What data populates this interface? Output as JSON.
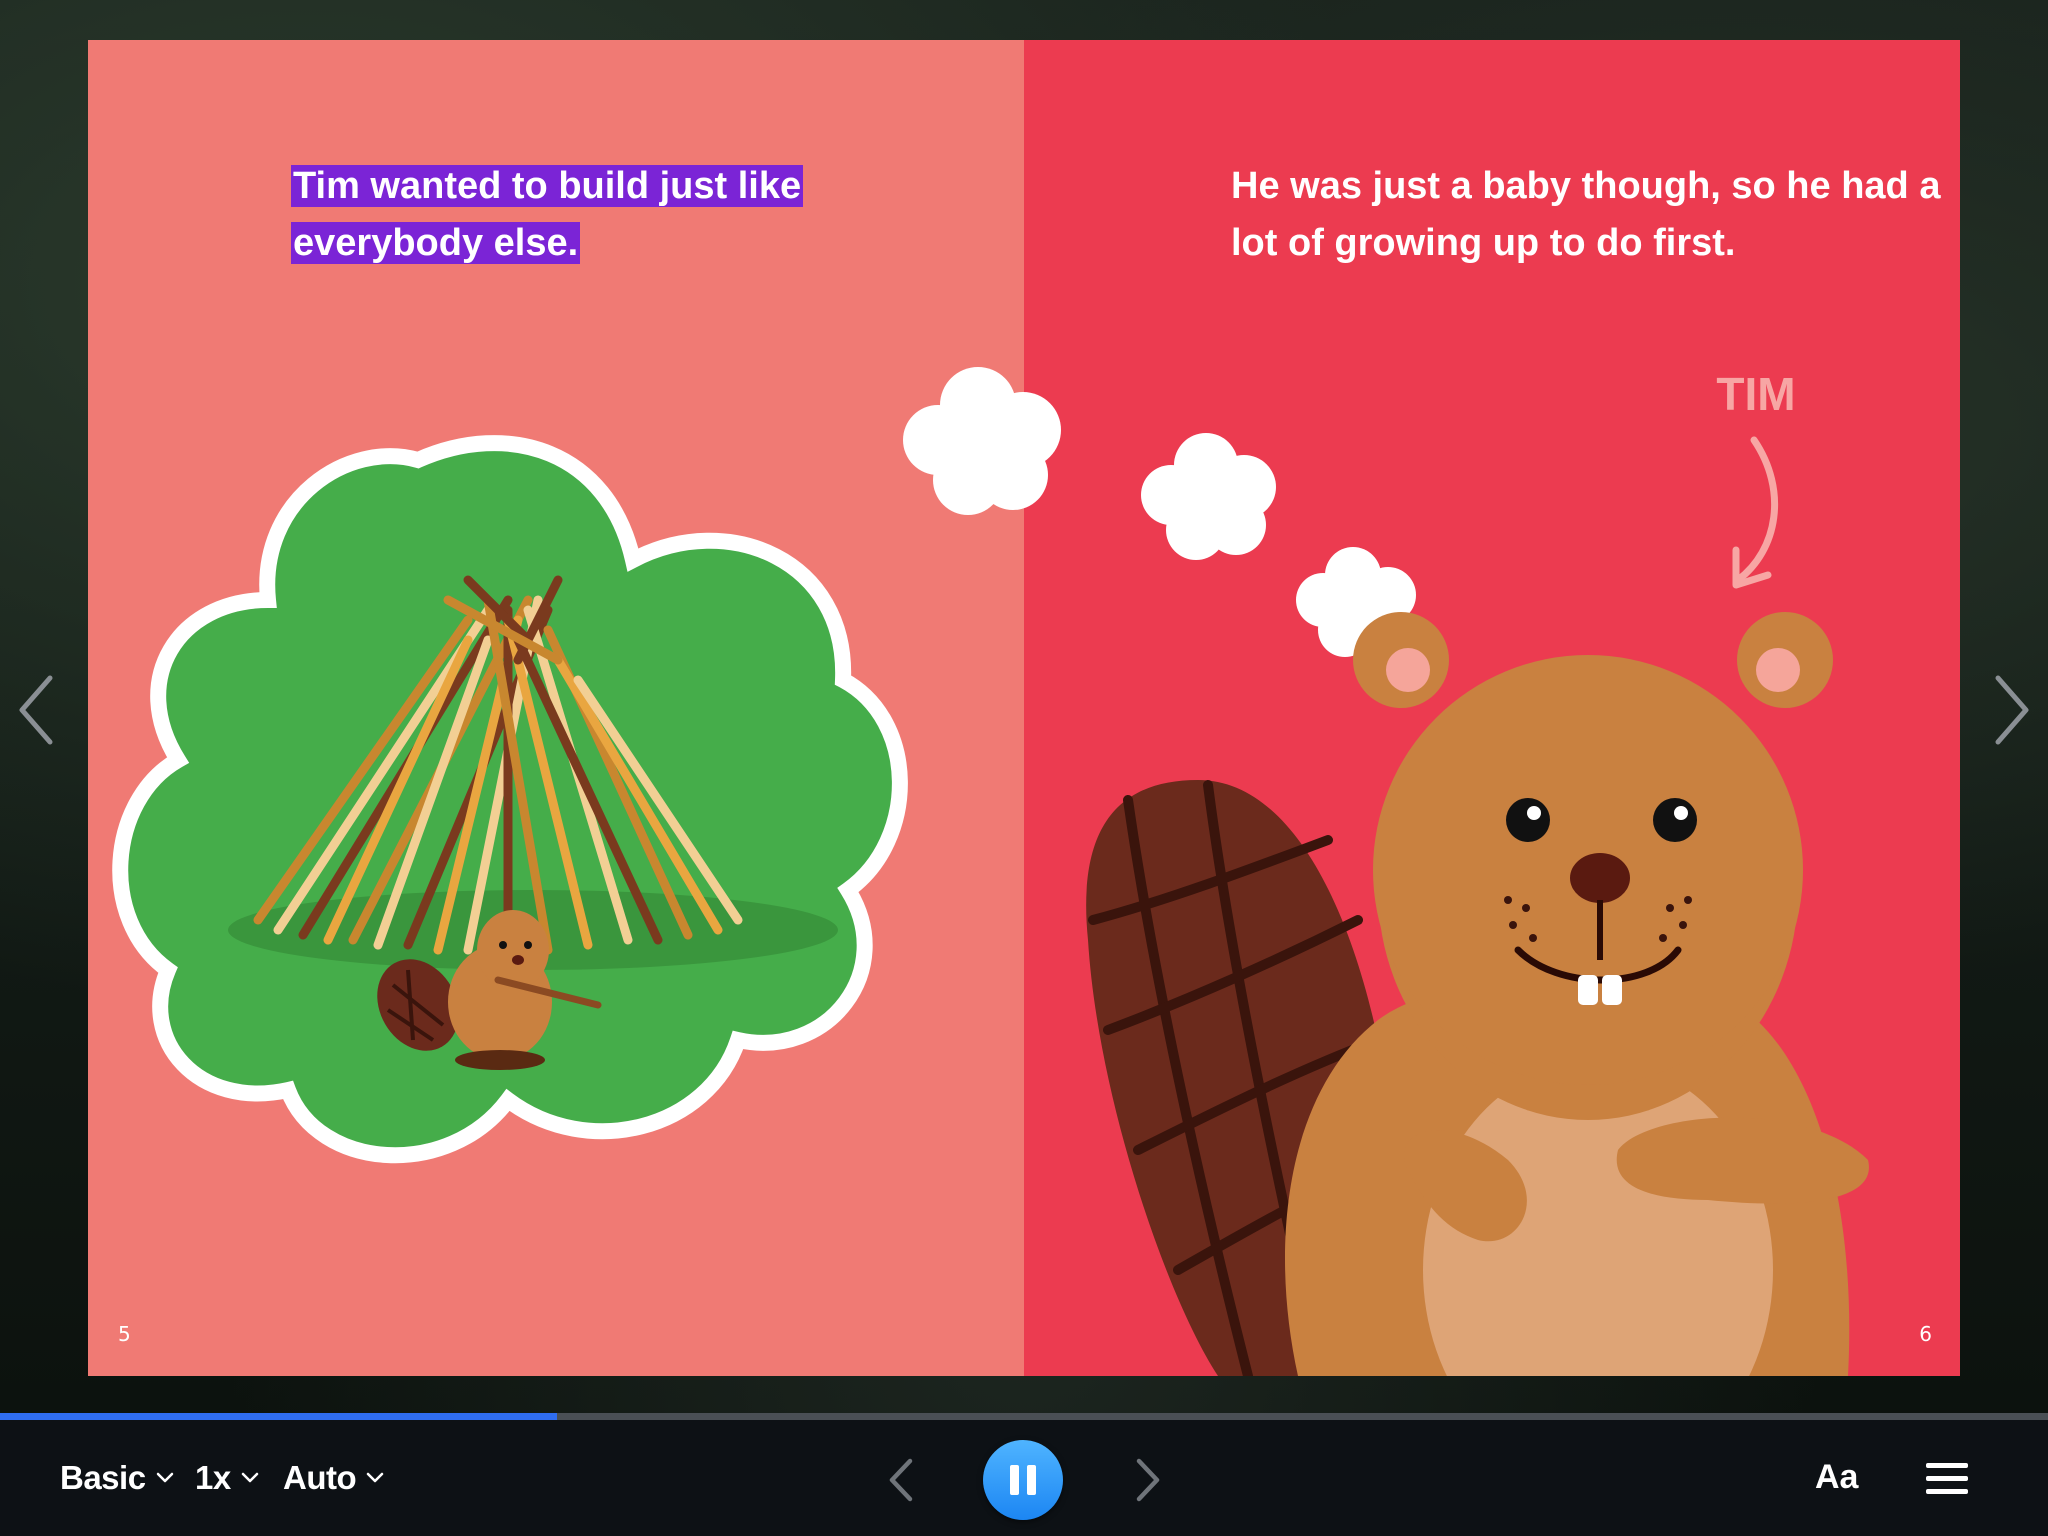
{
  "book": {
    "left_page": {
      "text": "Tim wanted to build just like everybody else.",
      "page_number": "5",
      "background_color": "#f07a74",
      "highlight_color": "#7b24d6"
    },
    "right_page": {
      "text": "He was just a baby though, so he had a lot of growing up to do first.",
      "page_number": "6",
      "background_color": "#ec3b50",
      "name_label": "TIM"
    }
  },
  "navigation": {
    "prev_page_icon": "chevron-left-icon",
    "next_page_icon": "chevron-right-icon"
  },
  "progress": {
    "fraction": 0.272,
    "fill_color": "#2f6df0"
  },
  "toolbar": {
    "mode_label": "Basic",
    "speed_label": "1x",
    "autoplay_label": "Auto",
    "play_state": "playing",
    "font_label": "Aa",
    "menu_icon": "hamburger-menu-icon",
    "accent_color": "#1c86f3"
  }
}
